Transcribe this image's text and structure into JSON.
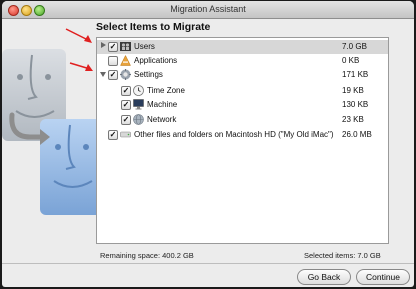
{
  "window": {
    "title": "Migration Assistant"
  },
  "heading": "Select Items to Migrate",
  "items": [
    {
      "label": "Users",
      "size": "7.0 GB",
      "checked": true,
      "icon": "users-icon"
    },
    {
      "label": "Applications",
      "size": "0 KB",
      "checked": false,
      "icon": "applications-icon"
    },
    {
      "label": "Settings",
      "size": "171 KB",
      "checked": true,
      "icon": "settings-icon"
    },
    {
      "label": "Time Zone",
      "size": "19 KB",
      "checked": true,
      "icon": "clock-icon"
    },
    {
      "label": "Machine",
      "size": "130 KB",
      "checked": true,
      "icon": "monitor-icon"
    },
    {
      "label": "Network",
      "size": "23 KB",
      "checked": true,
      "icon": "network-icon"
    },
    {
      "label": "Other files and folders on Macintosh HD  (\"My Old iMac\")",
      "size": "26.0 MB",
      "checked": true,
      "icon": "disk-icon"
    }
  ],
  "footer": {
    "remaining": "Remaining space: 400.2 GB",
    "selected": "Selected items: 7.0 GB"
  },
  "buttons": {
    "back": "Go Back",
    "continue": "Continue"
  },
  "colors": {
    "selection": "#d7d7d7",
    "arrow": "#e02020"
  }
}
